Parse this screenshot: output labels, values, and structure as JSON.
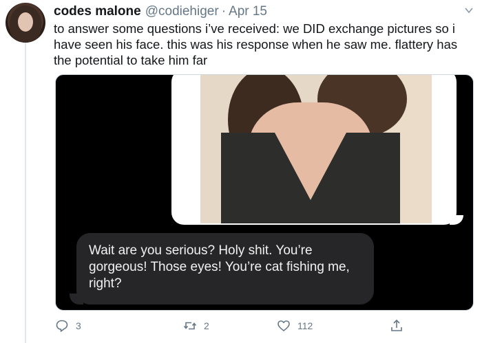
{
  "tweet": {
    "display_name": "codes malone",
    "handle": "@codiehiger",
    "separator": "·",
    "date": "Apr 15",
    "text": "to answer some questions i’ve received: we DID exchange pictures so i have seen his face. this was his response when he saw me. flattery has the potential to take him far"
  },
  "media": {
    "message_text": "Wait are you serious? Holy shit. You’re gorgeous! Those eyes! You’re cat fishing me, right?"
  },
  "actions": {
    "replies": "3",
    "retweets": "2",
    "likes": "112"
  },
  "colors": {
    "text": "#14171a",
    "secondary": "#657786",
    "message_bg": "#262628"
  }
}
